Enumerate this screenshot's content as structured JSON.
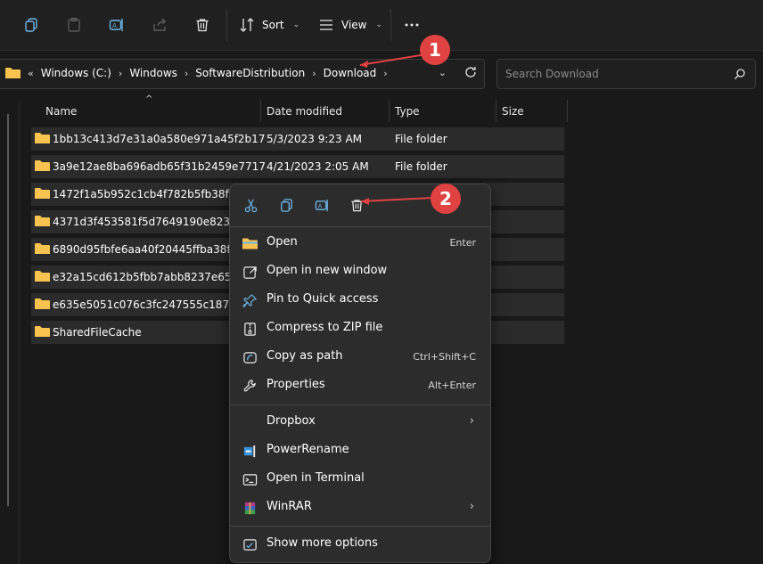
{
  "toolbar": {
    "sort_label": "Sort",
    "view_label": "View",
    "icons": [
      "copy-icon",
      "paste-icon",
      "rename-icon",
      "share-icon",
      "delete-icon",
      "sort-icon",
      "view-icon",
      "more-icon"
    ]
  },
  "address": {
    "breadcrumbs": [
      "Windows (C:)",
      "Windows",
      "SoftwareDistribution",
      "Download"
    ],
    "overflow": "«"
  },
  "search": {
    "placeholder": "Search Download"
  },
  "columns": {
    "name": "Name",
    "date": "Date modified",
    "type": "Type",
    "size": "Size"
  },
  "rows": [
    {
      "name": "1bb13c413d7e31a0a580e971a45f2b17",
      "date": "5/3/2023 9:23 AM",
      "type": "File folder"
    },
    {
      "name": "3a9e12ae8ba696adb65f31b2459e7717",
      "date": "4/21/2023 2:05 AM",
      "type": "File folder"
    },
    {
      "name": "1472f1a5b952c1cb4f782b5fb38f8058",
      "date": "",
      "type": ""
    },
    {
      "name": "4371d3f453581f5d7649190e82316e11",
      "date": "",
      "type": ""
    },
    {
      "name": "6890d95fbfe6aa40f20445ffba38f0ce",
      "date": "",
      "type": ""
    },
    {
      "name": "e32a15cd612b5fbb7abb8237e65b4e00",
      "date": "",
      "type": ""
    },
    {
      "name": "e635e5051c076c3fc247555c187c78ac",
      "date": "",
      "type": ""
    },
    {
      "name": "SharedFileCache",
      "date": "",
      "type": ""
    }
  ],
  "context_menu": {
    "quick_actions": [
      "cut-icon",
      "copy-icon",
      "rename-icon",
      "delete-icon"
    ],
    "items": [
      {
        "label": "Open",
        "shortcut": "Enter",
        "icon": "folder-icon"
      },
      {
        "label": "Open in new window",
        "shortcut": "",
        "icon": "new-window-icon"
      },
      {
        "label": "Pin to Quick access",
        "shortcut": "",
        "icon": "pin-icon"
      },
      {
        "label": "Compress to ZIP file",
        "shortcut": "",
        "icon": "zip-icon"
      },
      {
        "label": "Copy as path",
        "shortcut": "Ctrl+Shift+C",
        "icon": "copy-path-icon"
      },
      {
        "label": "Properties",
        "shortcut": "Alt+Enter",
        "icon": "wrench-icon"
      },
      {
        "label": "Dropbox",
        "shortcut": "",
        "icon": ""
      },
      {
        "label": "PowerRename",
        "shortcut": "",
        "icon": "powerrename-icon"
      },
      {
        "label": "Open in Terminal",
        "shortcut": "",
        "icon": "terminal-icon"
      },
      {
        "label": "WinRAR",
        "shortcut": "",
        "icon": "winrar-icon"
      },
      {
        "label": "Show more options",
        "shortcut": "",
        "icon": "more-options-icon"
      }
    ]
  },
  "annotations": [
    {
      "number": "1"
    },
    {
      "number": "2"
    }
  ],
  "colors": {
    "accent": "#60cdff",
    "badge": "#e04141",
    "folder": "#f8c44f"
  }
}
